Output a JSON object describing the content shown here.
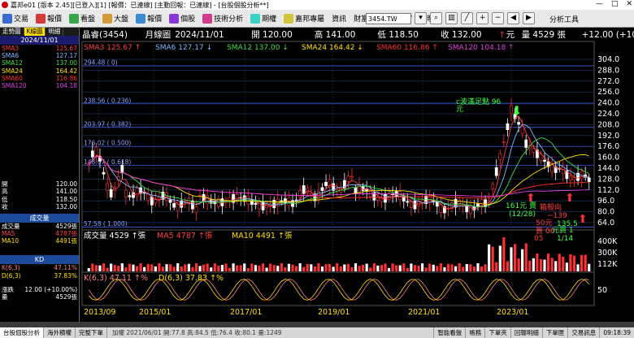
{
  "window": {
    "title": "嘉邦e01 [版本 2.45][已登入][1] [報價：已連線] [主動回報：已連線] - [台股個股分析**]",
    "controls": [
      "—",
      "□",
      "✕"
    ]
  },
  "toolbar": {
    "menus": [
      "交易",
      "報價",
      "看盤",
      "大盤",
      "報價",
      "個股",
      "技術分析",
      "期權",
      "嘉邦專屬",
      "資訊",
      "財富",
      "功能",
      "視窗",
      "說明"
    ],
    "symbol": "3454.TW",
    "analysis_tools": "分析工具"
  },
  "left_panel": {
    "tabs": [
      "走勢圖",
      "K線圖",
      "明細"
    ],
    "date": "2024/11/01",
    "ma": [
      {
        "label": "SMA3",
        "value": "125.67",
        "color": "#ff4040"
      },
      {
        "label": "SMA6",
        "value": "127.17",
        "color": "#7fb8ff"
      },
      {
        "label": "SMA12",
        "value": "137.00",
        "color": "#40e040"
      },
      {
        "label": "SMA24",
        "value": "164.42",
        "color": "#ffe000"
      },
      {
        "label": "SMA60",
        "value": "116.86",
        "color": "#ff3030"
      },
      {
        "label": "SMA120",
        "value": "104.18",
        "color": "#e040e0"
      }
    ],
    "ohlc": [
      {
        "label": "開",
        "value": "120.00"
      },
      {
        "label": "高",
        "value": "141.00"
      },
      {
        "label": "低",
        "value": "118.50"
      },
      {
        "label": "收",
        "value": "132.00"
      }
    ],
    "volume_head": "成交量",
    "volume_rows": [
      {
        "label": "成交量",
        "value": "4529張",
        "color": "#ffffff"
      },
      {
        "label": "MA5",
        "value": "4787張",
        "color": "#ff4040"
      },
      {
        "label": "MA10",
        "value": "4491張",
        "color": "#ffe000"
      }
    ],
    "kd_head": "KD",
    "kd_rows": [
      {
        "label": "K(6,3)",
        "value": "47.11%",
        "color": "#ff8080"
      },
      {
        "label": "D(6,3)",
        "value": "37.83%",
        "color": "#ffe000"
      }
    ],
    "bottom": [
      {
        "label": "漲跌",
        "value": "12.00 (+10.00%)"
      },
      {
        "label": "量",
        "value": "4529張"
      }
    ]
  },
  "chart": {
    "header": {
      "name": "晶睿(3454)",
      "period": "月線圖",
      "date": "2024/11/01",
      "open": "開 120.00",
      "high": "高 141.00",
      "low": "低 118.50",
      "close": "收 132.00",
      "unit": "元",
      "vol": "量 4529 張",
      "change": "+12.00 (+10.00%)"
    },
    "sma_legend": [
      {
        "text": "SMA3 125.67",
        "color": "#ff4040"
      },
      {
        "text": "SMA6 127.17",
        "color": "#7fb8ff"
      },
      {
        "text": "SMA12 137.00",
        "color": "#40e040"
      },
      {
        "text": "SMA24 164.42",
        "color": "#ffe000"
      },
      {
        "text": "SMA60 116.86",
        "color": "#ff3030"
      },
      {
        "text": "SMA120 104.18",
        "color": "#e040e0"
      }
    ],
    "price_axis": [
      "304.0",
      "288.0",
      "272.0",
      "256.0",
      "240.0",
      "224.0",
      "208.0",
      "192.0",
      "176.0",
      "160.0",
      "144.0",
      "128.0",
      "112.0",
      "96.0",
      "80.0",
      "64.0"
    ],
    "fib_levels": [
      {
        "label": "294.48 ( 0)",
        "price": 294.48
      },
      {
        "label": "238.56 ( 0.236)",
        "price": 238.56
      },
      {
        "label": "203.97 ( 0.382)",
        "price": 203.97
      },
      {
        "label": "176.02 ( 0.500)",
        "price": 176.02
      },
      {
        "label": "148.07 ( 0.618)",
        "price": 148.07
      },
      {
        "label": "57.58 ( 1.000)",
        "price": 57.58
      }
    ],
    "annotations": [
      {
        "text": "c波滿足點 96",
        "color": "#40ff40"
      },
      {
        "text": "元",
        "color": "#40ff40"
      },
      {
        "text": "161元 賣",
        "color": "#40ff40"
      },
      {
        "text": "(12/28)",
        "color": "#40ff40"
      },
      {
        "text": "箱般向",
        "color": "#ff4040"
      },
      {
        "text": "~139",
        "color": "#ff4040"
      },
      {
        "text": "50元",
        "color": "#ff4040"
      },
      {
        "text": "買 06",
        "color": "#ff4040"
      },
      {
        "text": "05",
        "color": "#ff4040"
      },
      {
        "text": "135.5",
        "color": "#40ff40"
      },
      {
        "text": "元買 1",
        "color": "#40ff40"
      },
      {
        "text": "1/14",
        "color": "#40ff40"
      }
    ],
    "volume_legend": [
      {
        "text": "成交量 4529",
        "color": "#ffffff"
      },
      {
        "text": "MA5 4787",
        "color": "#ff4040"
      },
      {
        "text": "MA10 4491",
        "color": "#ffe000"
      }
    ],
    "volume_axis": [
      "400K",
      "300K",
      "112K"
    ],
    "kd_legend": [
      {
        "text": "K(6,3) 47.11",
        "color": "#ff8080"
      },
      {
        "text": "D(6,3) 37.83",
        "color": "#ffe000"
      }
    ],
    "kd_axis": [
      "50"
    ],
    "time_axis": [
      "2013/09",
      "2015/01",
      "2017/01",
      "2019/01",
      "2021/01",
      "2023/01"
    ]
  },
  "statusbar": {
    "tabs": [
      "台股個股分析",
      "海外積權",
      "完整下單"
    ],
    "info": "加權 2021/06/01 開:77.8 高:84.5 低:76.4 收:80.1 量:1249",
    "right": [
      "智能看盤",
      "帳務",
      "下單夾",
      "回報明細",
      "下單匣",
      "交易訊息"
    ],
    "time": "09:18:39"
  },
  "colors": {
    "up": "#ff3030",
    "down": "#ffffff",
    "grid": "#1e3a6e",
    "fib": "#4a6aff"
  }
}
